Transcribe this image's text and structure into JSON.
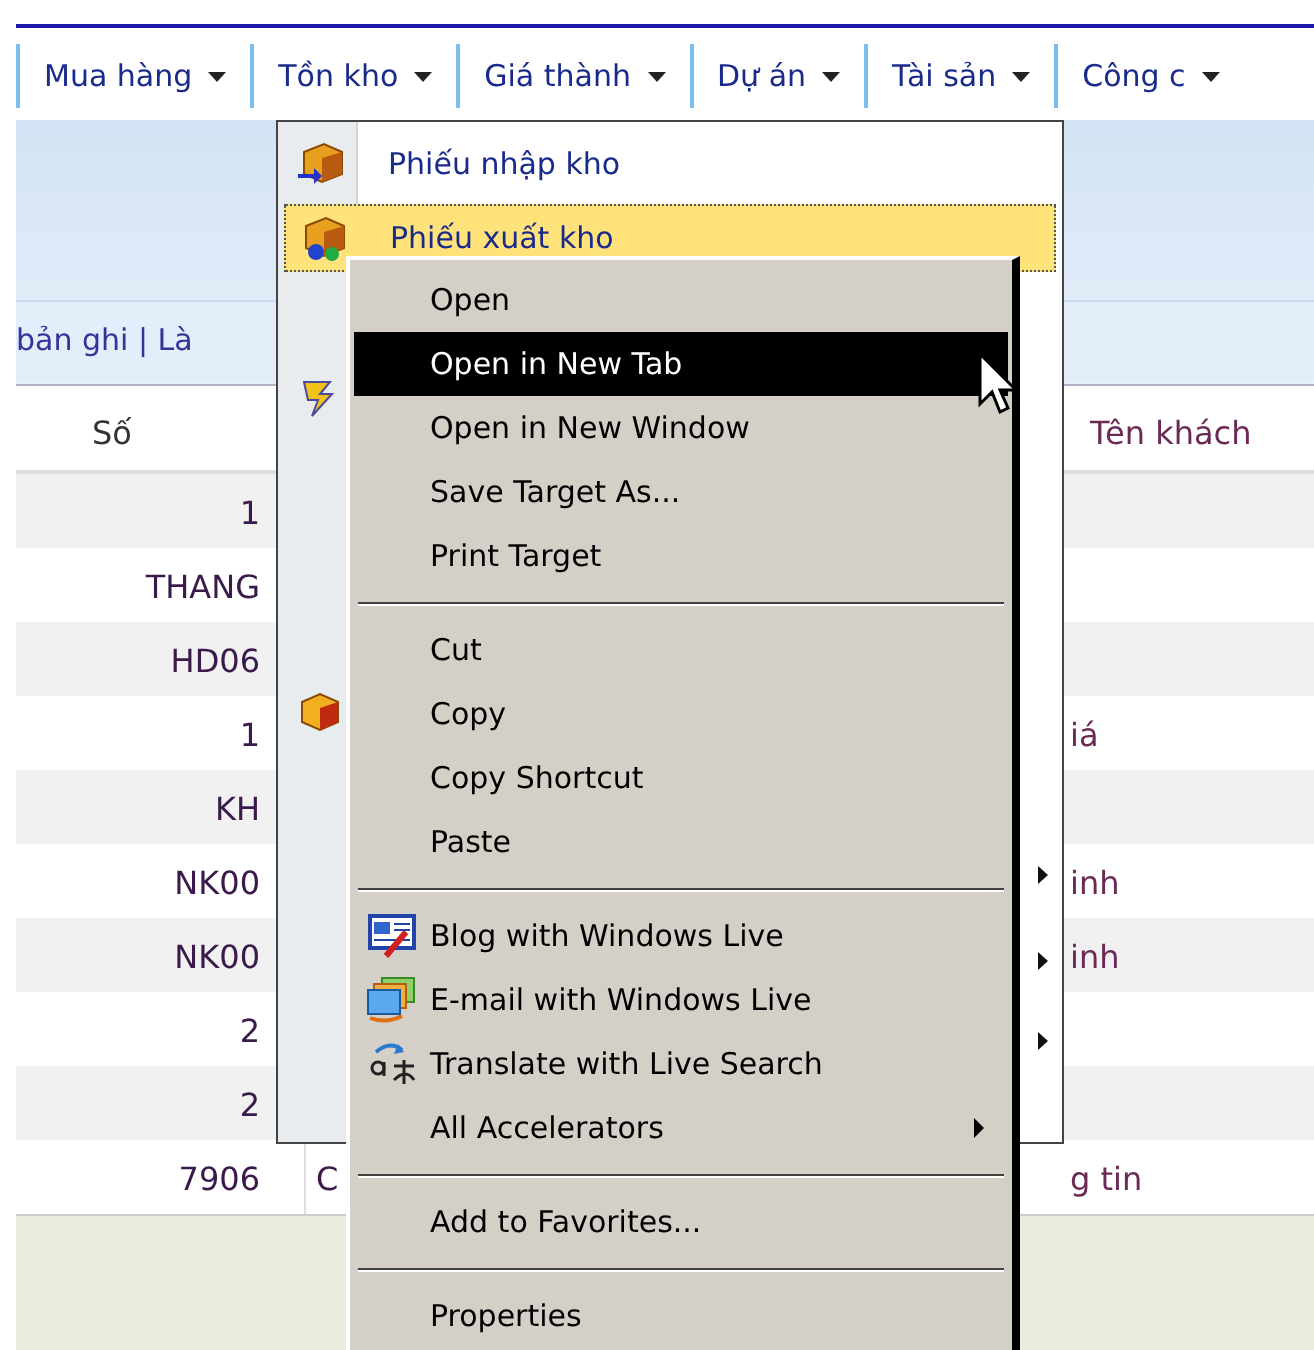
{
  "nav": [
    {
      "label": "Mua hàng"
    },
    {
      "label": "Tồn kho"
    },
    {
      "label": "Giá thành"
    },
    {
      "label": "Dự án"
    },
    {
      "label": "Tài sản"
    },
    {
      "label": "Công c"
    }
  ],
  "toolbar": {
    "text": "bản ghi | Là"
  },
  "table": {
    "columns": [
      "Số",
      "Tên khách"
    ],
    "rows": [
      {
        "so": "1"
      },
      {
        "so": "THANG"
      },
      {
        "so": "HD06"
      },
      {
        "so": "1",
        "khach": "iá"
      },
      {
        "so": "KH"
      },
      {
        "so": "NK00",
        "khach": "inh"
      },
      {
        "so": "NK00",
        "khach": "inh"
      },
      {
        "so": "2"
      },
      {
        "so": "2"
      },
      {
        "so": "7906",
        "col_2": "C",
        "khach": "g tin"
      }
    ]
  },
  "dropdown": {
    "items": [
      {
        "label": "Phiếu nhập kho",
        "kind": "import",
        "selected": false
      },
      {
        "label": "Phiếu xuất kho",
        "kind": "export",
        "selected": true
      }
    ]
  },
  "context_menu": {
    "items": [
      {
        "kind": "item",
        "label": "Open",
        "selected": false
      },
      {
        "kind": "item",
        "label": "Open in New Tab",
        "selected": true
      },
      {
        "kind": "item",
        "label": "Open in New Window",
        "selected": false
      },
      {
        "kind": "item",
        "label": "Save Target As...",
        "selected": false
      },
      {
        "kind": "item",
        "label": "Print Target",
        "selected": false
      },
      {
        "kind": "separator"
      },
      {
        "kind": "item",
        "label": "Cut",
        "selected": false
      },
      {
        "kind": "item",
        "label": "Copy",
        "selected": false
      },
      {
        "kind": "item",
        "label": "Copy Shortcut",
        "selected": false
      },
      {
        "kind": "item",
        "label": "Paste",
        "selected": false
      },
      {
        "kind": "separator"
      },
      {
        "kind": "blog",
        "label": "Blog with Windows Live",
        "selected": false
      },
      {
        "kind": "email",
        "label": "E-mail with Windows Live",
        "selected": false
      },
      {
        "kind": "translate",
        "label": "Translate with Live Search",
        "selected": false
      },
      {
        "kind": "item",
        "label": "All Accelerators",
        "selected": false,
        "submenu": true
      },
      {
        "kind": "separator"
      },
      {
        "kind": "item",
        "label": "Add to Favorites...",
        "selected": false
      },
      {
        "kind": "separator"
      },
      {
        "kind": "item",
        "label": "Properties",
        "selected": false
      }
    ]
  }
}
